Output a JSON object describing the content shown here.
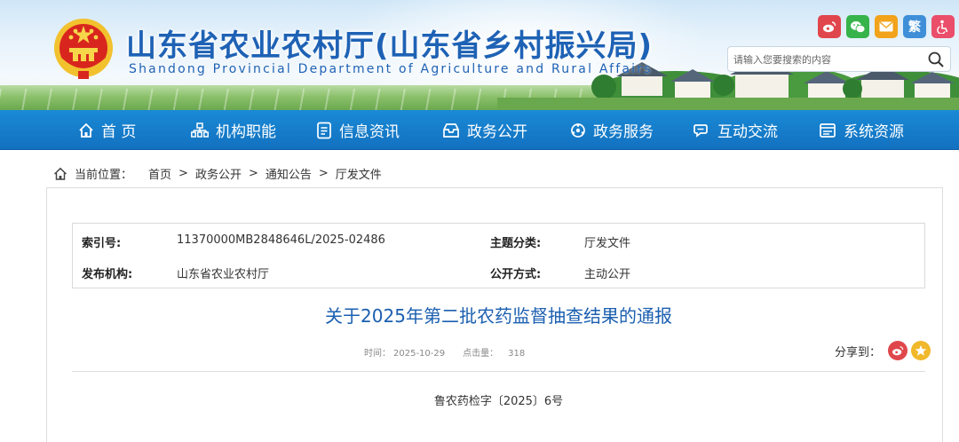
{
  "header": {
    "title": "山东省农业农村厅(山东省乡村振兴局)",
    "subtitle": "Shandong Provincial Department of Agriculture and Rural Affairs",
    "quick_icons": [
      {
        "name": "weibo-icon",
        "label": ""
      },
      {
        "name": "wechat-icon",
        "label": ""
      },
      {
        "name": "mail-icon",
        "label": ""
      },
      {
        "name": "traditional-chinese",
        "label": "繁"
      },
      {
        "name": "accessibility-icon",
        "label": ""
      }
    ],
    "search": {
      "placeholder": "请输入您要搜索的内容",
      "value": ""
    }
  },
  "nav": {
    "items": [
      {
        "label": "首 页",
        "icon": "home-icon"
      },
      {
        "label": "机构职能",
        "icon": "org-chart-icon"
      },
      {
        "label": "信息资讯",
        "icon": "document-icon"
      },
      {
        "label": "政务公开",
        "icon": "inbox-icon"
      },
      {
        "label": "政务服务",
        "icon": "service-icon"
      },
      {
        "label": "互动交流",
        "icon": "chat-icon"
      },
      {
        "label": "系统资源",
        "icon": "window-icon"
      }
    ]
  },
  "breadcrumb": {
    "label": "当前位置：",
    "items": [
      "首页",
      "政务公开",
      "通知公告",
      "厅发文件"
    ],
    "separator": ">"
  },
  "meta": {
    "index_no_label": "索引号:",
    "index_no": "11370000MB2848646L/2025-02486",
    "topic_label": "主题分类:",
    "topic": "厅发文件",
    "publisher_label": "发布机构:",
    "publisher": "山东省农业农村厅",
    "disclosure_label": "公开方式:",
    "disclosure": "主动公开"
  },
  "article": {
    "title": "关于2025年第二批农药监督抽查结果的通报",
    "time_label": "时间：",
    "time": "2025-10-29",
    "views_label": "点击量：",
    "views": "318",
    "share_label": "分享到：",
    "doc_number": "鲁农药检字〔2025〕6号"
  },
  "colors": {
    "brand_blue": "#1e62b5",
    "nav_blue": "#1271c0",
    "weibo_red": "#e0474c",
    "wechat_green": "#36b34a",
    "mail_orange": "#f2a31b",
    "qzone_yellow": "#f0b82a"
  }
}
